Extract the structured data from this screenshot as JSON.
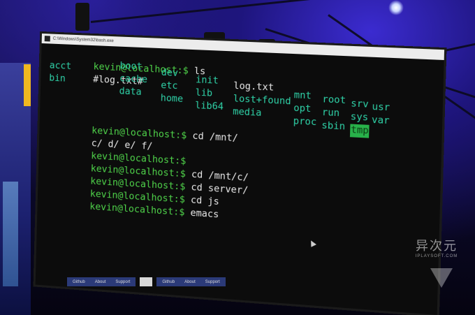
{
  "window": {
    "title": "C:\\Windows\\System32\\bash.exe"
  },
  "terminal": {
    "lines_before_ls": [
      {
        "prompt": "kevin@localhost:$",
        "command": " ls"
      },
      {
        "prompt": "#log.txt#",
        "command": ""
      }
    ],
    "ls_entries": [
      {
        "name": "acct",
        "kind": "dir"
      },
      {
        "name": "bin",
        "kind": "dir"
      },
      {
        "name": "boot",
        "kind": "dir"
      },
      {
        "name": "cache",
        "kind": "dir"
      },
      {
        "name": "data",
        "kind": "dir"
      },
      {
        "name": "dev",
        "kind": "dir"
      },
      {
        "name": "etc",
        "kind": "dir"
      },
      {
        "name": "home",
        "kind": "dir"
      },
      {
        "name": "init",
        "kind": "dir"
      },
      {
        "name": "lib",
        "kind": "dir"
      },
      {
        "name": "lib64",
        "kind": "dir"
      },
      {
        "name": "log.txt",
        "kind": "file"
      },
      {
        "name": "lost+found",
        "kind": "dir"
      },
      {
        "name": "media",
        "kind": "dir"
      },
      {
        "name": "mnt",
        "kind": "dir"
      },
      {
        "name": "opt",
        "kind": "dir"
      },
      {
        "name": "proc",
        "kind": "dir"
      },
      {
        "name": "root",
        "kind": "dir"
      },
      {
        "name": "run",
        "kind": "dir"
      },
      {
        "name": "sbin",
        "kind": "dir"
      },
      {
        "name": "srv",
        "kind": "dir"
      },
      {
        "name": "sys",
        "kind": "dir"
      },
      {
        "name": "tmp",
        "kind": "dir",
        "highlight": true
      },
      {
        "name": "usr",
        "kind": "dir"
      },
      {
        "name": "var",
        "kind": "dir"
      }
    ],
    "lines_after_ls": [
      {
        "prompt": "kevin@localhost:$",
        "command": " cd /mnt/"
      },
      {
        "prompt": "",
        "command": "c/ d/ e/ f/"
      },
      {
        "prompt": "kevin@localhost:$",
        "command": ""
      },
      {
        "prompt": "kevin@localhost:$",
        "command": " cd /mnt/c/"
      },
      {
        "prompt": "kevin@localhost:$",
        "command": " cd server/"
      },
      {
        "prompt": "kevin@localhost:$",
        "command": " cd js"
      },
      {
        "prompt": "kevin@localhost:$",
        "command": " emacs"
      }
    ]
  },
  "taskbar": {
    "group1": [
      "Github",
      "About",
      "Support"
    ],
    "group2": [
      "Github",
      "About",
      "Support"
    ]
  },
  "watermark": {
    "main": "异次元",
    "sub": "IPLAYSOFT.COM"
  },
  "colors": {
    "prompt": "#4fd34a",
    "directory": "#2fd2a8",
    "highlight_bg": "#28b14a"
  }
}
